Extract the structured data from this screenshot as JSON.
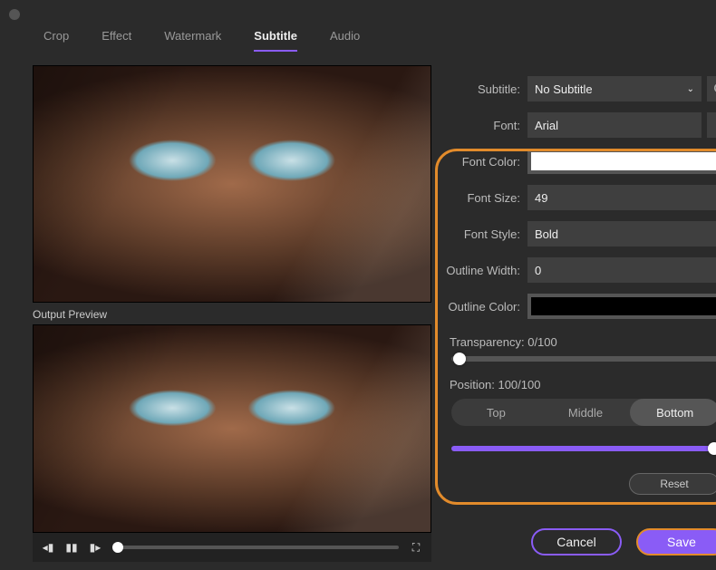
{
  "tabs": {
    "crop": "Crop",
    "effect": "Effect",
    "watermark": "Watermark",
    "subtitle": "Subtitle",
    "audio": "Audio",
    "active": "subtitle"
  },
  "left": {
    "output_preview_label": "Output Preview"
  },
  "panel": {
    "subtitle": {
      "label": "Subtitle:",
      "value": "No Subtitle"
    },
    "font": {
      "label": "Font:",
      "value": "Arial"
    },
    "font_color": {
      "label": "Font Color:",
      "value": "#FFFFFF"
    },
    "font_size": {
      "label": "Font Size:",
      "value": "49"
    },
    "font_style": {
      "label": "Font Style:",
      "value": "Bold"
    },
    "outline_width": {
      "label": "Outline Width:",
      "value": "0"
    },
    "outline_color": {
      "label": "Outline Color:",
      "value": "#000000"
    },
    "transparency": {
      "label_prefix": "Transparency:",
      "value": 0,
      "max": 100,
      "display": "Transparency: 0/100"
    },
    "position_label": "Position: 100/100",
    "position_value": 100,
    "position_max": 100,
    "segments": {
      "top": "Top",
      "middle": "Middle",
      "bottom": "Bottom",
      "active": "bottom"
    },
    "reset": "Reset"
  },
  "footer": {
    "cancel": "Cancel",
    "save": "Save"
  }
}
